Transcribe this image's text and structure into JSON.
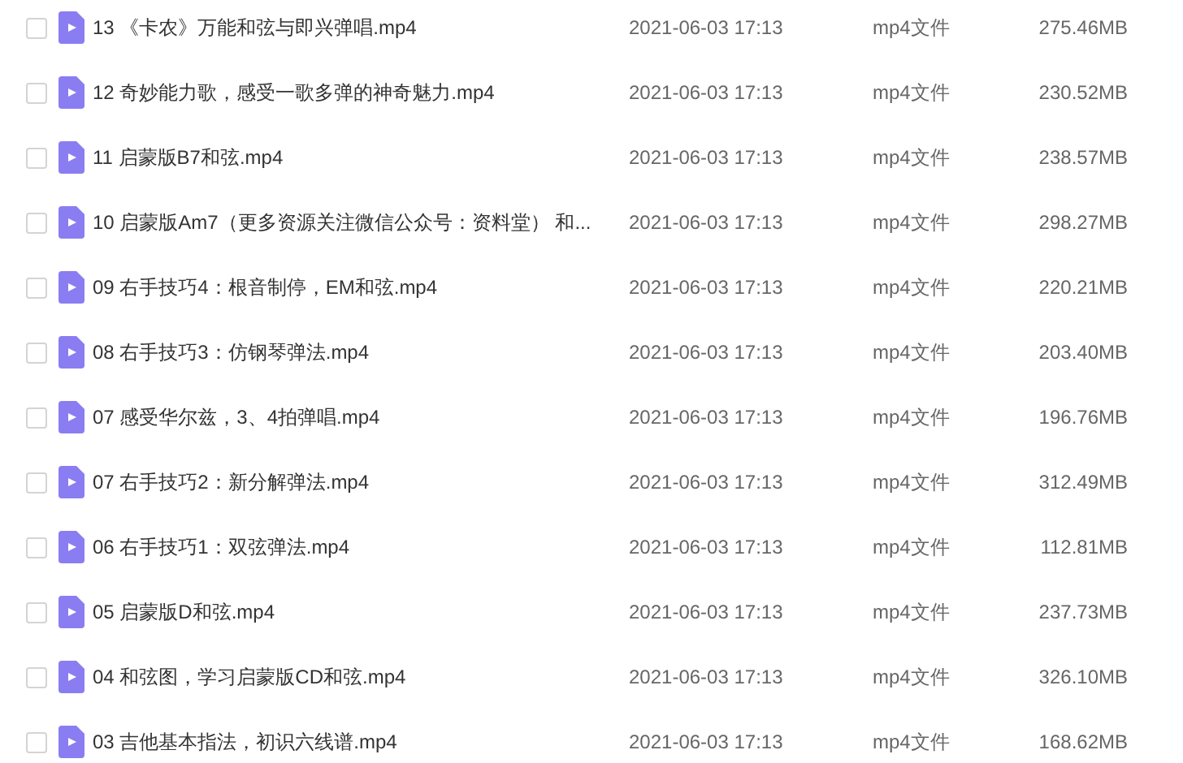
{
  "files": [
    {
      "name": "13 《卡农》万能和弦与即兴弹唱.mp4",
      "modified": "2021-06-03 17:13",
      "type": "mp4文件",
      "size": "275.46MB",
      "checked": false
    },
    {
      "name": "12 奇妙能力歌，感受一歌多弹的神奇魅力.mp4",
      "modified": "2021-06-03 17:13",
      "type": "mp4文件",
      "size": "230.52MB",
      "checked": false
    },
    {
      "name": "11 启蒙版B7和弦.mp4",
      "modified": "2021-06-03 17:13",
      "type": "mp4文件",
      "size": "238.57MB",
      "checked": false
    },
    {
      "name": "10 启蒙版Am7（更多资源关注微信公众号：资料堂） 和...",
      "modified": "2021-06-03 17:13",
      "type": "mp4文件",
      "size": "298.27MB",
      "checked": false
    },
    {
      "name": "09 右手技巧4：根音制停，EM和弦.mp4",
      "modified": "2021-06-03 17:13",
      "type": "mp4文件",
      "size": "220.21MB",
      "checked": false
    },
    {
      "name": "08 右手技巧3：仿钢琴弹法.mp4",
      "modified": "2021-06-03 17:13",
      "type": "mp4文件",
      "size": "203.40MB",
      "checked": false
    },
    {
      "name": "07 感受华尔兹，3、4拍弹唱.mp4",
      "modified": "2021-06-03 17:13",
      "type": "mp4文件",
      "size": "196.76MB",
      "checked": false
    },
    {
      "name": "07 右手技巧2：新分解弹法.mp4",
      "modified": "2021-06-03 17:13",
      "type": "mp4文件",
      "size": "312.49MB",
      "checked": false
    },
    {
      "name": "06 右手技巧1：双弦弹法.mp4",
      "modified": "2021-06-03 17:13",
      "type": "mp4文件",
      "size": "112.81MB",
      "checked": false
    },
    {
      "name": "05 启蒙版D和弦.mp4",
      "modified": "2021-06-03 17:13",
      "type": "mp4文件",
      "size": "237.73MB",
      "checked": false
    },
    {
      "name": "04 和弦图，学习启蒙版CD和弦.mp4",
      "modified": "2021-06-03 17:13",
      "type": "mp4文件",
      "size": "326.10MB",
      "checked": false
    },
    {
      "name": "03 吉他基本指法，初识六线谱.mp4",
      "modified": "2021-06-03 17:13",
      "type": "mp4文件",
      "size": "168.62MB",
      "checked": false
    }
  ]
}
